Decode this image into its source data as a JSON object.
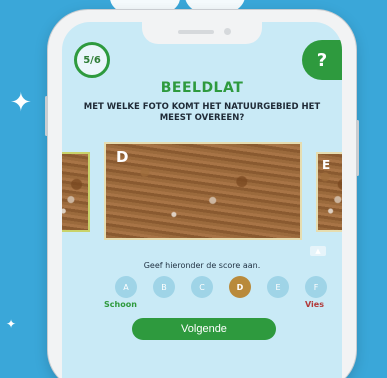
{
  "app": {
    "progress": "5/6",
    "help_label": "?"
  },
  "header": {
    "title": "BEELDLAT",
    "question": "MET WELKE FOTO KOMT HET NATUURGEBIED HET MEEST OVEREEN?"
  },
  "carousel": {
    "main_letter": "D",
    "right_letter": "E"
  },
  "scoring": {
    "instruction": "Geef hieronder de score aan.",
    "options": [
      "A",
      "B",
      "C",
      "D",
      "E",
      "F"
    ],
    "selected": "D",
    "left_label": "Schoon",
    "right_label": "Vies"
  },
  "actions": {
    "next_label": "Volgende"
  },
  "colors": {
    "brand_green": "#2e9a3e",
    "selected_brown": "#b98a3b",
    "dirty_red": "#b23a3a",
    "option_blue": "#9fd4e7"
  }
}
